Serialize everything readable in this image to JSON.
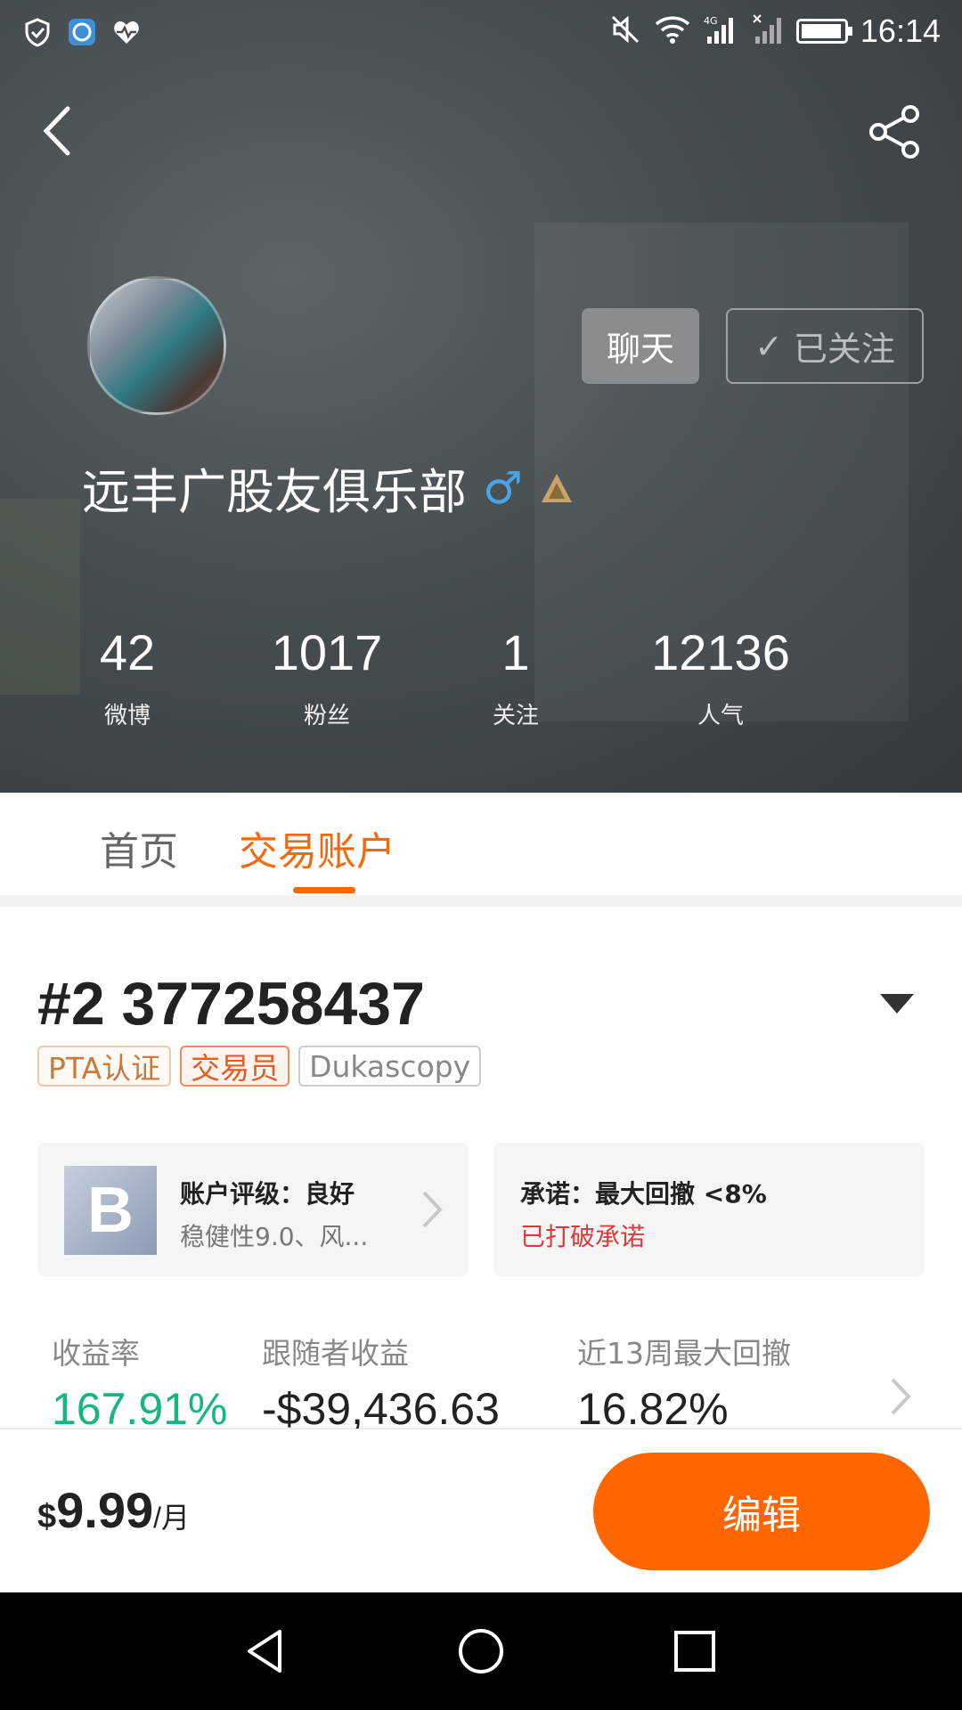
{
  "status_bar": {
    "time": "16:14",
    "battery_level": 0.9,
    "left_icons": [
      "shield-check-icon",
      "browser-icon",
      "heartbeat-icon"
    ],
    "right_icons": [
      "mute-icon",
      "wifi-icon",
      "signal-4g-icon",
      "signal-no-sim-icon",
      "battery-icon"
    ]
  },
  "header": {
    "back_icon": "chevron-left-icon",
    "share_icon": "share-icon"
  },
  "profile": {
    "name": "远丰广股友俱乐部",
    "gender_symbol": "♂",
    "gender_color": "#4aa3e6",
    "chat_label": "聊天",
    "follow_label": "已关注",
    "follow_check": "✓"
  },
  "stats": [
    {
      "value": "42",
      "label": "微博"
    },
    {
      "value": "1017",
      "label": "粉丝"
    },
    {
      "value": "1",
      "label": "关注"
    },
    {
      "value": "12136",
      "label": "人气"
    }
  ],
  "tabs": {
    "home": "首页",
    "trade": "交易账户",
    "active": "trade",
    "accent": "#f26a0f"
  },
  "account": {
    "title": "#2 377258437",
    "tags": [
      "PTA认证",
      "交易员",
      "Dukascopy"
    ],
    "rating_grade": "B",
    "rating_title": "账户评级：良好",
    "rating_detail": "稳健性9.0、风...",
    "promise_title": "承诺：最大回撤 <8%",
    "promise_status": "已打破承诺"
  },
  "metrics": [
    {
      "label": "收益率",
      "value": "167.91%"
    },
    {
      "label": "跟随者收益",
      "value": "-$39,436.63"
    },
    {
      "label": "近13周最大回撤",
      "value": "16.82%"
    }
  ],
  "bottom": {
    "currency": "$",
    "price": "9.99",
    "period": "/月",
    "edit_label": "编辑",
    "edit_color": "#ff6600"
  }
}
